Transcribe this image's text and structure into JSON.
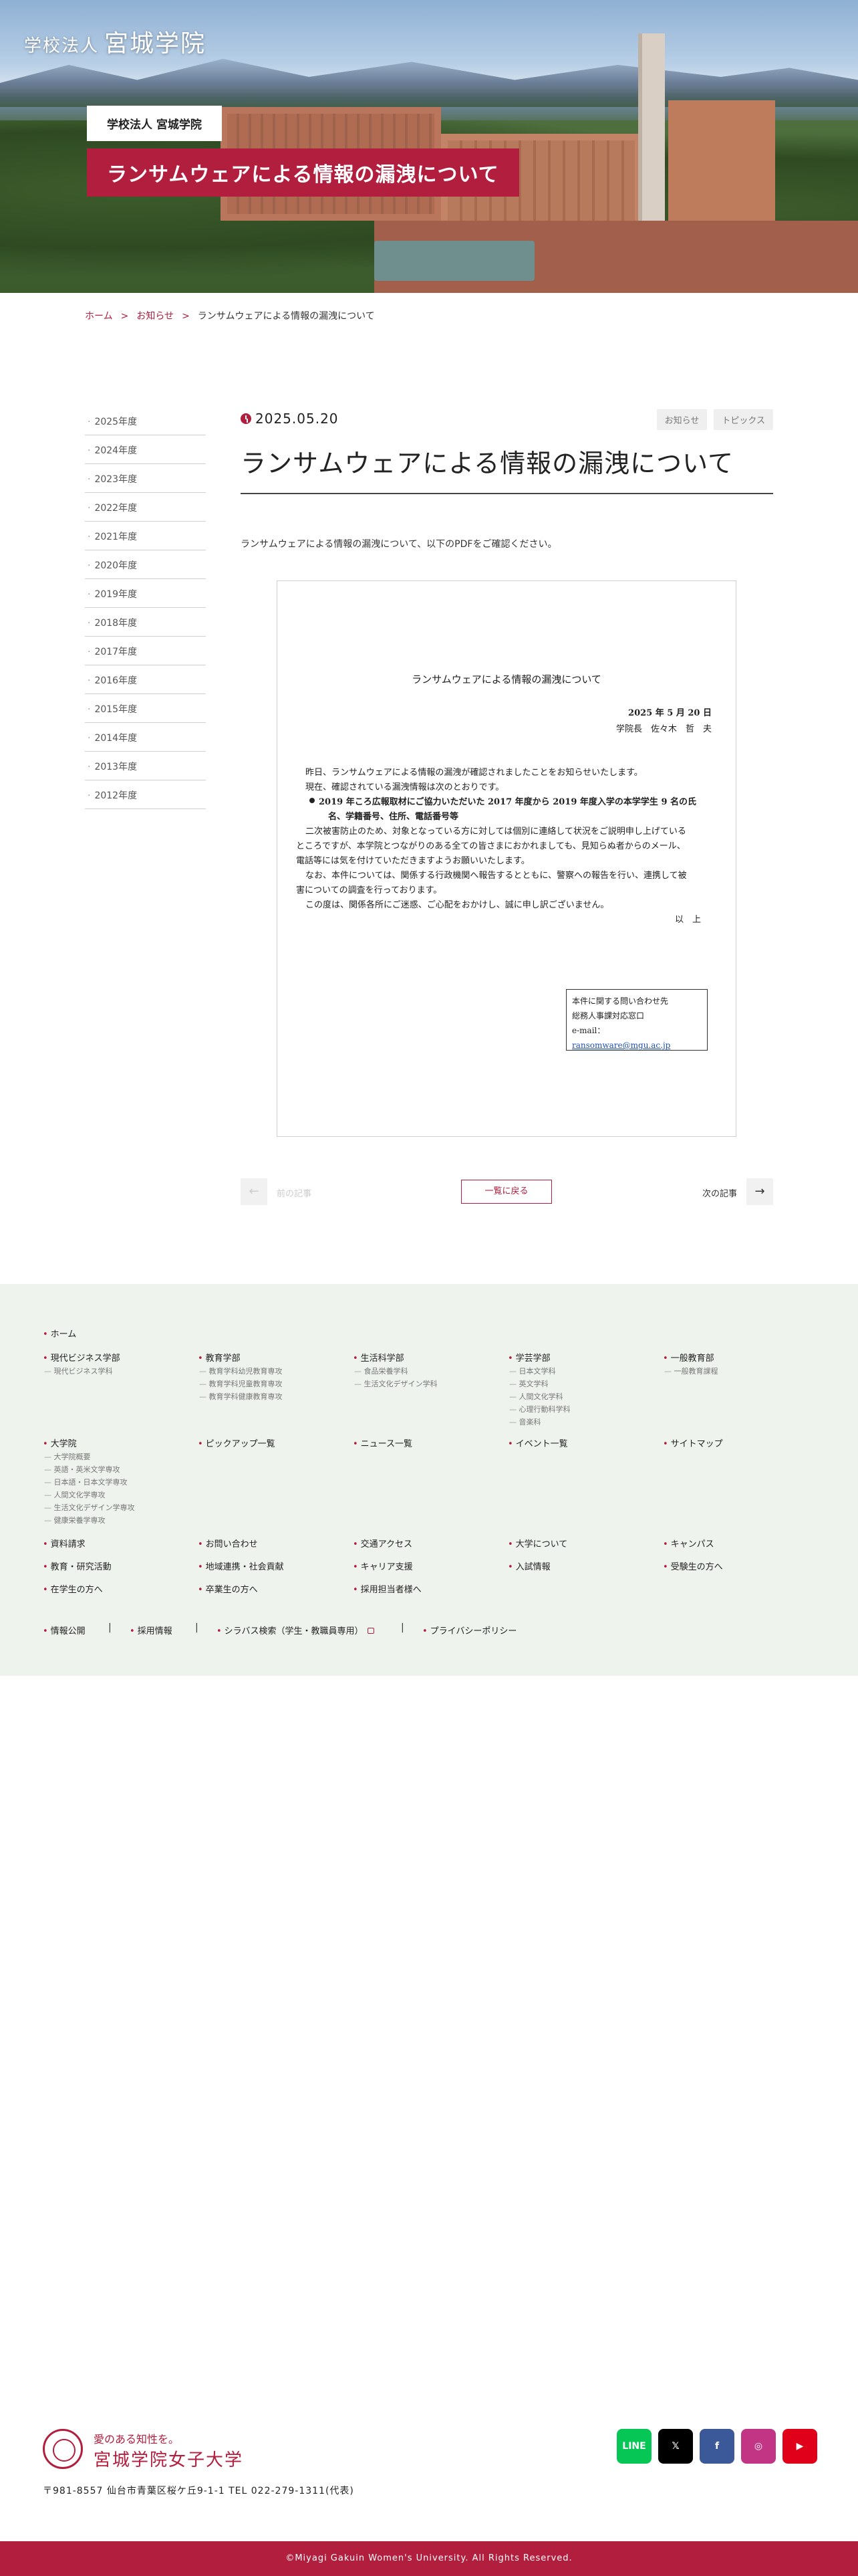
{
  "hero": {
    "logo_small": "学校法人",
    "logo_main": "宮城学院",
    "org_label": "学校法人 宮城学院",
    "title": "ランサムウェアによる情報の漏洩について"
  },
  "breadcrumb": {
    "home": "ホーム",
    "news": "お知らせ",
    "current": "ランサムウェアによる情報の漏洩について",
    "separator": ">"
  },
  "sidebar": {
    "years": [
      "2025年度",
      "2024年度",
      "2023年度",
      "2022年度",
      "2021年度",
      "2020年度",
      "2019年度",
      "2018年度",
      "2017年度",
      "2016年度",
      "2015年度",
      "2014年度",
      "2013年度",
      "2012年度"
    ]
  },
  "article": {
    "date": "2025.05.20",
    "tags": [
      "お知らせ",
      "トピックス"
    ],
    "title": "ランサムウェアによる情報の漏洩について",
    "lead": "ランサムウェアによる情報の漏洩について、以下のPDFをご確認ください。"
  },
  "document": {
    "title": "ランサムウェアによる情報の漏洩について",
    "date": "2025 年 5 月 20 日",
    "signature": "学院長　佐々木　哲　夫",
    "para1": "昨日、ランサムウェアによる情報の漏洩が確認されましたことをお知らせいたします。",
    "para2": "現在、確認されている漏洩情報は次のとおりです。",
    "bullet_1": "2019 年ころ広報取材にご協力いただいた 2017 年度から 2019 年度入学の本学学生 9 名の氏",
    "bullet_2": "名、学籍番号、住所、電話番号等",
    "para3_1": "二次被害防止のため、対象となっている方に対しては個別に連絡して状況をご説明申し上げている",
    "para3_2": "ところですが、本学院とつながりのある全ての皆さまにおかれましても、見知らぬ者からのメール、",
    "para3_3": "電話等には気を付けていただきますようお願いいたします。",
    "para4_1": "なお、本件については、関係する行政機関へ報告するとともに、警察への報告を行い、連携して被",
    "para4_2": "害についての調査を行っております。",
    "para5": "この度は、関係各所にご迷惑、ご心配をおかけし、誠に申し訳ございません。",
    "closing": "以　上",
    "contact_1": "本件に関する問い合わせ先",
    "contact_2": "総務人事課対応窓口",
    "contact_3_label": "e-mail：",
    "contact_3_mail": "ransomware@mgu.ac.jp"
  },
  "pager": {
    "prev": "前の記事",
    "back": "一覧に戻る",
    "next": "次の記事",
    "prev_arrow": "←",
    "next_arrow": "→"
  },
  "footer_nav": {
    "home": "ホーム",
    "col1_title": "現代ビジネス学部",
    "col1_subs": [
      "現代ビジネス学科"
    ],
    "col2_title": "教育学部",
    "col2_subs": [
      "教育学科幼児教育専攻",
      "教育学科児童教育専攻",
      "教育学科健康教育専攻"
    ],
    "col3_title": "生活科学部",
    "col3_subs": [
      "食品栄養学科",
      "生活文化デザイン学科"
    ],
    "col4_title": "学芸学部",
    "col4_subs": [
      "日本文学科",
      "英文学科",
      "人間文化学科",
      "心理行動科学科",
      "音楽科"
    ],
    "col5_title": "一般教育部",
    "col5_subs": [
      "一般教育課程"
    ],
    "grad_title": "大学院",
    "grad_subs": [
      "大学院概要",
      "英語・英米文学専攻",
      "日本語・日本文学専攻",
      "人間文化学専攻",
      "生活文化デザイン学専攻",
      "健康栄養学専攻"
    ],
    "pickup": "ピックアップ一覧",
    "news_list": "ニュース一覧",
    "events": "イベント一覧",
    "sitemap": "サイトマップ",
    "row3": [
      "資料請求",
      "お問い合わせ",
      "交通アクセス",
      "大学について",
      "キャンパス"
    ],
    "row4": [
      "教育・研究活動",
      "地域連携・社会貢献",
      "キャリア支援",
      "入試情報",
      "受験生の方へ"
    ],
    "row5": [
      "在学生の方へ",
      "卒業生の方へ",
      "採用担当者様へ"
    ],
    "bottom_links": [
      "情報公開",
      "採用情報",
      "シラバス検索（学生・教職員専用）",
      "プライバシーポリシー"
    ],
    "pipe": "|"
  },
  "footer": {
    "tagline": "愛のある知性を。",
    "university": "宮城学院女子大学",
    "address": "〒981-8557 仙台市青葉区桜ケ丘9-1-1 TEL 022-279-1311(代表)",
    "social": [
      {
        "name": "LINE",
        "label": "LINE",
        "color": "#06c755"
      },
      {
        "name": "X",
        "label": "𝕏",
        "color": "#000000"
      },
      {
        "name": "Facebook",
        "label": "f",
        "color": "#3b5998"
      },
      {
        "name": "Instagram",
        "label": "◎",
        "color": "#c13584"
      },
      {
        "name": "YouTube",
        "label": "▶",
        "color": "#e0001a"
      }
    ],
    "copyright": "©Miyagi Gakuin Women's University. All Rights Reserved."
  },
  "colors": {
    "accent": "#b21e3d",
    "footer_bg": "#eef3ee"
  }
}
